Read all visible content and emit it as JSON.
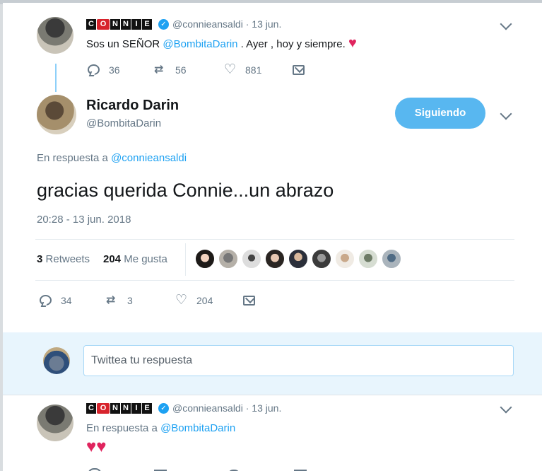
{
  "tweet1": {
    "display_name": "CONNIE",
    "handle": "@connieansaldi",
    "date": "13 jun.",
    "text": "Sos un SEÑOR",
    "mention": "@BombitaDarin",
    "text_after": ". Ayer , hoy y siempre.",
    "emoji": "♥",
    "replies": "36",
    "retweets": "56",
    "likes": "881"
  },
  "main_tweet": {
    "name": "Ricardo Darin",
    "handle": "@BombitaDarin",
    "follow_label": "Siguiendo",
    "in_reply_prefix": "En respuesta a",
    "in_reply_to": "@connieansaldi",
    "text": "gracias querida Connie...un abrazo",
    "timestamp": "20:28 - 13 jun. 2018",
    "retweets_count": "3",
    "retweets_label": "Retweets",
    "likes_count": "204",
    "likes_label": "Me gusta",
    "replies": "34",
    "retweets": "3",
    "likes": "204"
  },
  "reply_box": {
    "placeholder": "Twittea tu respuesta"
  },
  "tweet3": {
    "display_name": "CONNIE",
    "handle": "@connieansaldi",
    "date": "13 jun.",
    "in_reply_prefix": "En respuesta a",
    "in_reply_to": "@BombitaDarin",
    "emoji": "♥♥"
  },
  "colors": {
    "accent": "#1da1f2",
    "heart": "#e0245e",
    "muted": "#657786",
    "reply_bg": "#e8f5fd"
  }
}
